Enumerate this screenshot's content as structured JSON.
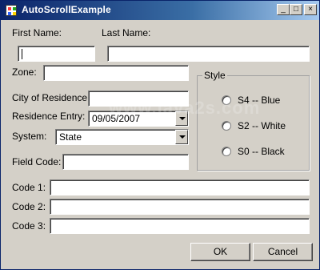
{
  "window": {
    "title": "AutoScrollExample",
    "controls": {
      "minimize_glyph": "_",
      "maximize_glyph": "□",
      "close_glyph": "×"
    }
  },
  "form": {
    "first_name_label": "First Name:",
    "last_name_label": "Last Name:",
    "first_name_value": "",
    "last_name_value": "",
    "zone_label": "Zone:",
    "zone_value": "",
    "city_label": "City of Residence:",
    "city_value": "",
    "residence_entry_label": "Residence Entry:",
    "residence_entry_value": "09/05/2007",
    "system_label": "System:",
    "system_value": "State",
    "field_code_label": "Field Code:",
    "field_code_value": "",
    "code1_label": "Code 1:",
    "code1_value": "",
    "code2_label": "Code 2:",
    "code2_value": "",
    "code3_label": "Code 3:",
    "code3_value": ""
  },
  "style_group": {
    "title": "Style",
    "options": [
      {
        "label": "S4 -- Blue"
      },
      {
        "label": "S2 -- White"
      },
      {
        "label": "S0 -- Black"
      }
    ]
  },
  "buttons": {
    "ok_label": "OK",
    "cancel_label": "Cancel"
  },
  "watermark_text": "www.java2s.com",
  "colors": {
    "window_bg": "#d4d0c8",
    "titlebar_start": "#0a246a",
    "titlebar_end": "#a6caf0",
    "text": "#000000"
  },
  "icons": {
    "app_icon": "app-icon",
    "minimize": "minimize-icon",
    "maximize": "maximize-icon",
    "close": "close-icon",
    "dropdown": "chevron-down-icon",
    "radio": "radio-button-icon"
  }
}
